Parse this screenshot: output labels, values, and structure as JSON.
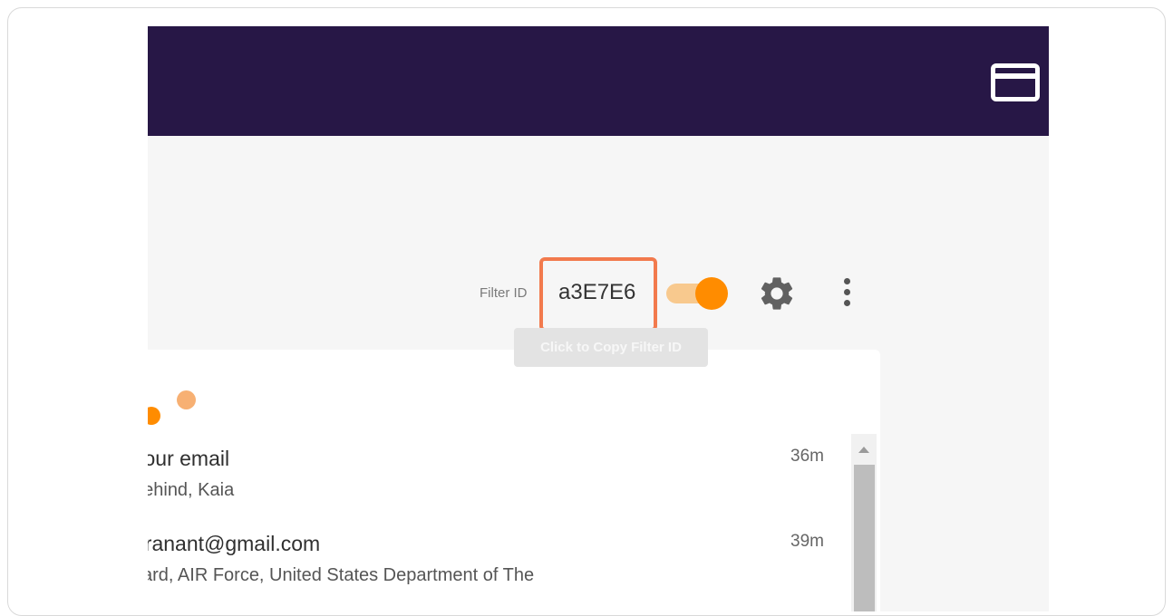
{
  "header": {
    "icon": "window-icon"
  },
  "filter": {
    "label": "Filter ID",
    "value": "a3E7E6",
    "tooltip": "Click to Copy Filter ID",
    "toggle_on": true
  },
  "toolbar": {
    "settings_icon": "gear-icon",
    "menu_icon": "more-vertical-icon"
  },
  "colors": {
    "header_bg": "#271746",
    "accent": "#ff8c00",
    "highlight_border": "#f27a4d"
  },
  "messages": [
    {
      "subject": "your email",
      "snippet": "behind, Kaia",
      "time": "36m"
    },
    {
      "subject": "granant@gmail.com",
      "snippet": "vard, AIR Force, United States Department of The",
      "time": "39m"
    }
  ]
}
